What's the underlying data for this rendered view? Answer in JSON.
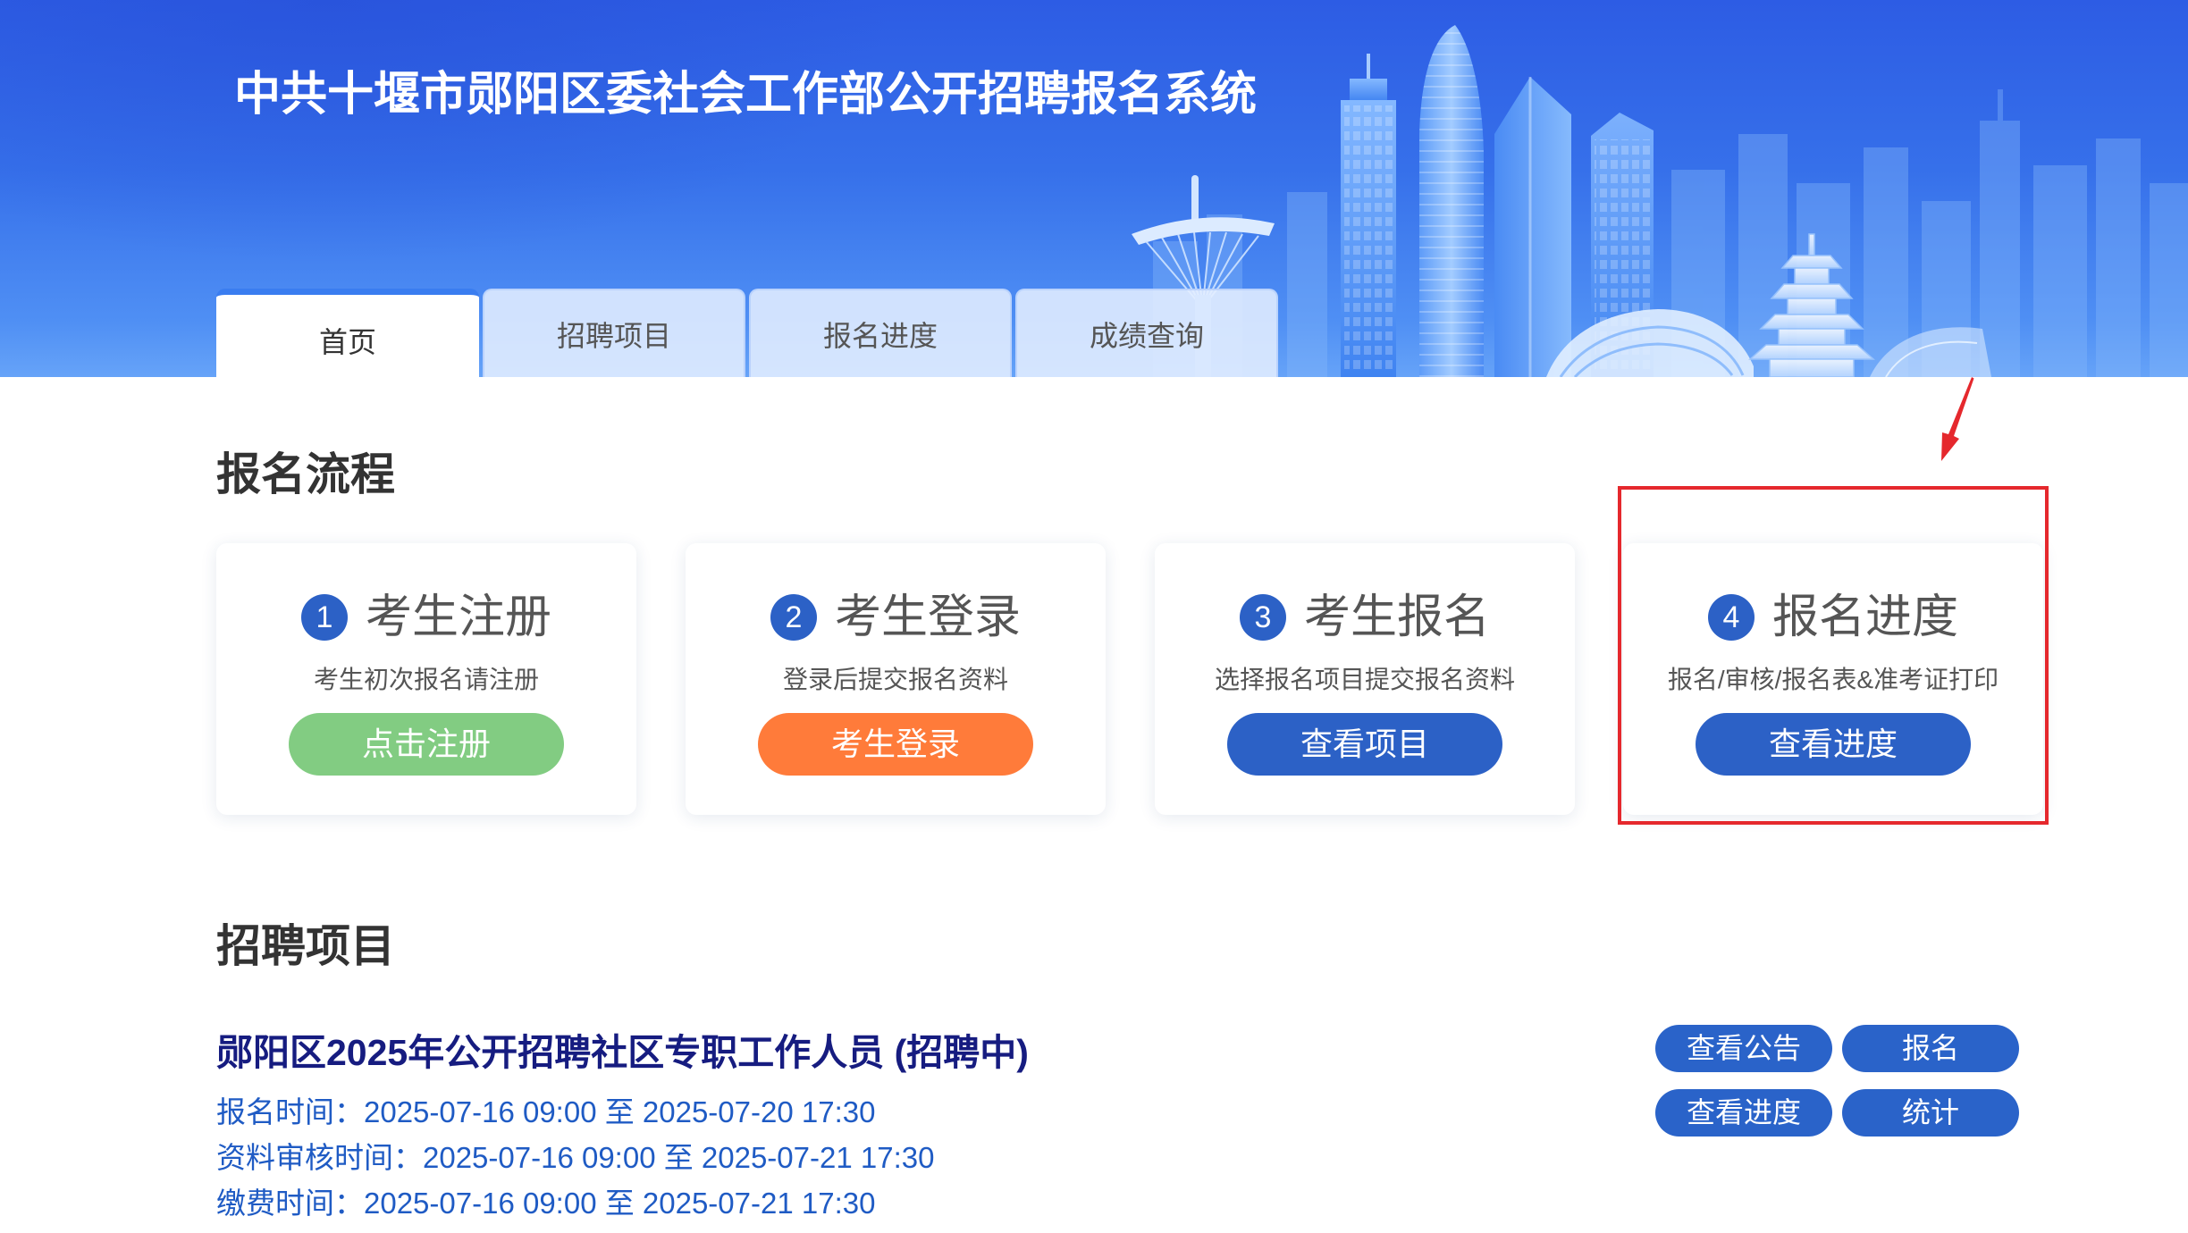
{
  "header": {
    "title": "中共十堰市郧阳区委社会工作部公开招聘报名系统",
    "tabs": [
      {
        "label": "首页",
        "selected": true
      },
      {
        "label": "招聘项目",
        "selected": false
      },
      {
        "label": "报名进度",
        "selected": false
      },
      {
        "label": "成绩查询",
        "selected": false
      }
    ]
  },
  "process": {
    "heading": "报名流程",
    "steps": [
      {
        "number": "1",
        "title": "考生注册",
        "description": "考生初次报名请注册",
        "button_label": "点击注册",
        "button_color": "#82cc82"
      },
      {
        "number": "2",
        "title": "考生登录",
        "description": "登录后提交报名资料",
        "button_label": "考生登录",
        "button_color": "#ff7b3a"
      },
      {
        "number": "3",
        "title": "考生报名",
        "description": "选择报名项目提交报名资料",
        "button_label": "查看项目",
        "button_color": "#2c61c6"
      },
      {
        "number": "4",
        "title": "报名进度",
        "description": "报名/审核/报名表&准考证打印",
        "button_label": "查看进度",
        "button_color": "#2c61c6"
      }
    ]
  },
  "recruitment": {
    "heading": "招聘项目",
    "projects": [
      {
        "title": "郧阳区2025年公开招聘社区专职工作人员 (招聘中)",
        "schedule": [
          {
            "label": "报名时间：",
            "value": "2025-07-16 09:00 至 2025-07-20 17:30"
          },
          {
            "label": "资料审核时间：",
            "value": "2025-07-16 09:00 至 2025-07-21 17:30"
          },
          {
            "label": "缴费时间：",
            "value": "2025-07-16 09:00 至 2025-07-21 17:30"
          }
        ],
        "actions": [
          {
            "label": "查看公告"
          },
          {
            "label": "报名"
          },
          {
            "label": "查看进度"
          },
          {
            "label": "统计"
          }
        ]
      }
    ]
  },
  "annotation": {
    "color": "#e5282d"
  },
  "colors": {
    "accent_blue": "#2c61c6",
    "action_blue": "#2a63c9",
    "project_title": "#161c80",
    "schedule_text": "#1f5bc4"
  }
}
